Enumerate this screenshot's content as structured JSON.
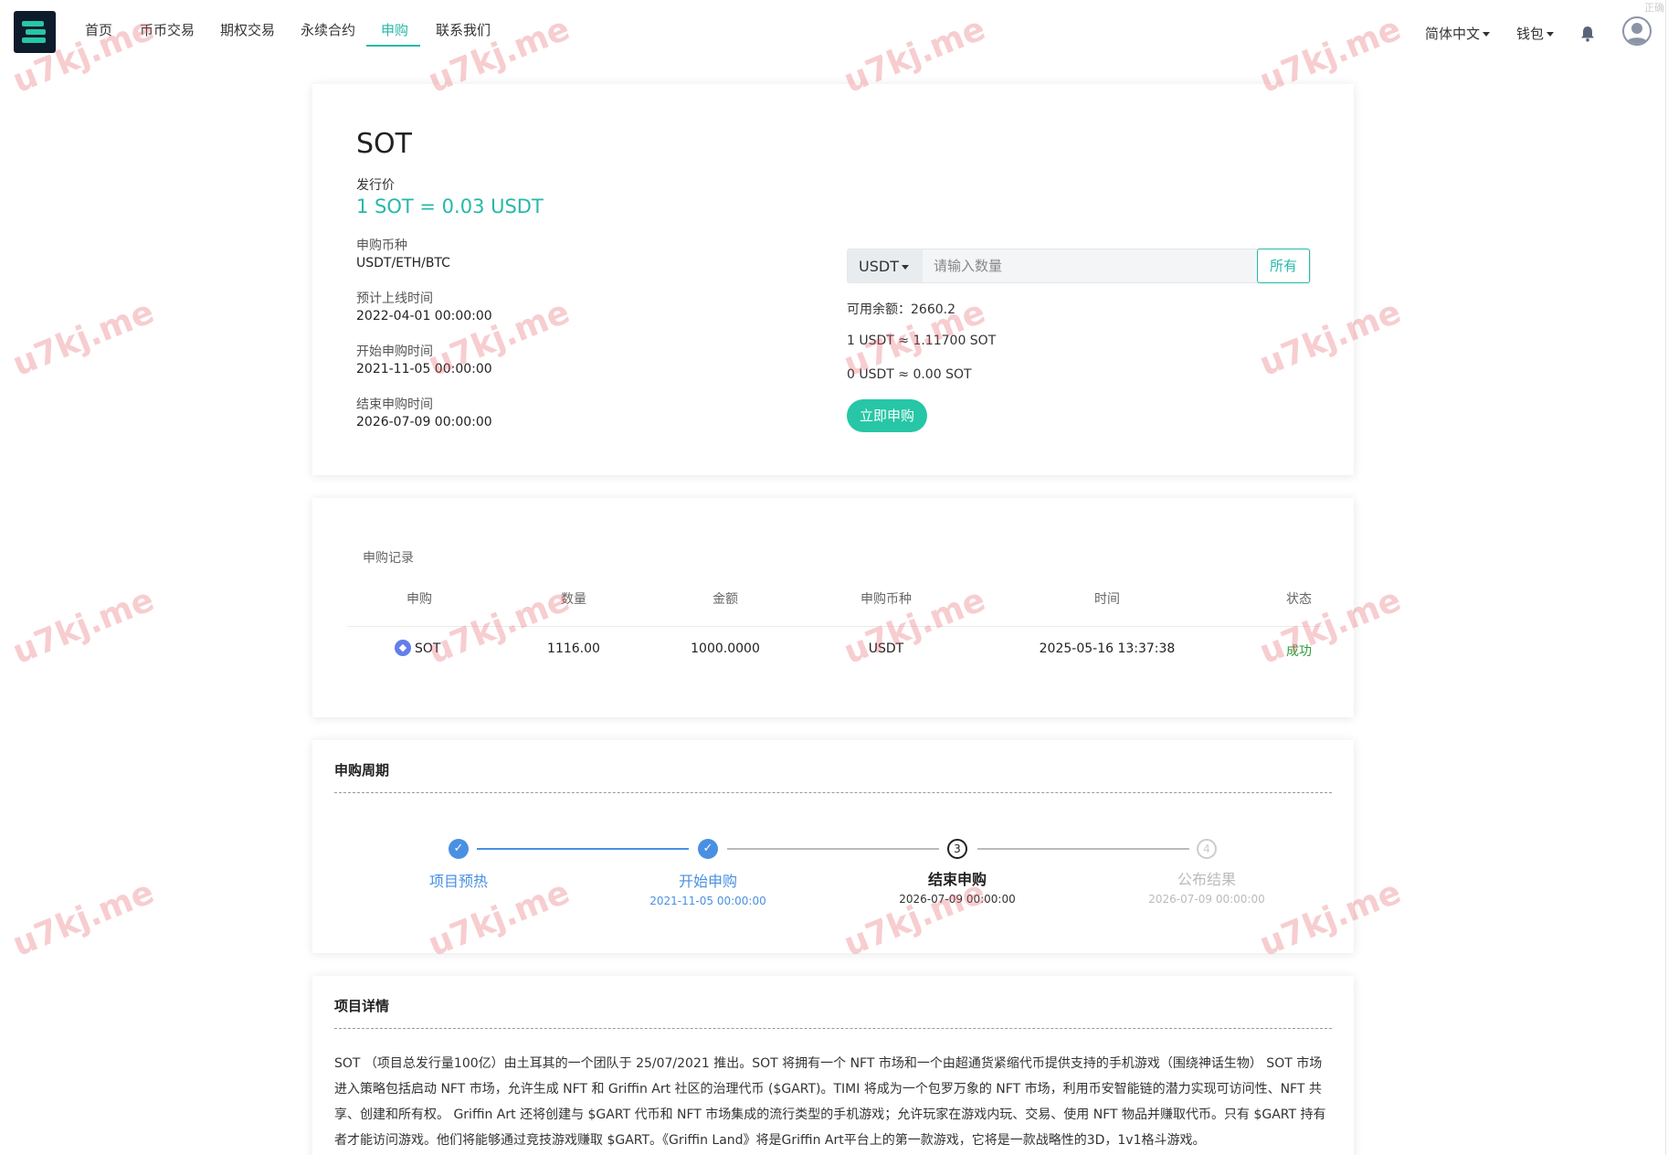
{
  "nav": {
    "items": [
      "首页",
      "币币交易",
      "期权交易",
      "永续合约",
      "申购",
      "联系我们"
    ],
    "active": "申购",
    "language": "简体中文",
    "wallet": "钱包",
    "corner_text": "正确"
  },
  "subscribe": {
    "coin": "SOT",
    "issue_price_label": "发行价",
    "issue_price": "1 SOT = 0.03 USDT",
    "currency_label": "申购币种",
    "currency_value": "USDT/ETH/BTC",
    "listing_label": "预计上线时间",
    "listing_value": "2022-04-01 00:00:00",
    "start_label": "开始申购时间",
    "start_value": "2021-11-05 00:00:00",
    "end_label": "结束申购时间",
    "end_value": "2026-07-09 00:00:00",
    "selected_currency": "USDT",
    "amount_placeholder": "请输入数量",
    "all_label": "所有",
    "balance": "可用余额：2660.2",
    "rate": "1 USDT ≈ 1.11700 SOT",
    "estimate": "0 USDT ≈ 0.00 SOT",
    "buy_label": "立即申购"
  },
  "records": {
    "title": "申购记录",
    "headers": [
      "申购",
      "数量",
      "金额",
      "申购币种",
      "时间",
      "状态"
    ],
    "rows": [
      {
        "coin": "SOT",
        "amount": "1116.00",
        "money": "1000.0000",
        "currency": "USDT",
        "time": "2025-05-16 13:37:38",
        "status": "成功"
      }
    ],
    "status_color": "#2e9e3e"
  },
  "period": {
    "title": "申购周期",
    "steps": [
      {
        "label": "项目预热",
        "date": "",
        "state": "done",
        "num": "✓"
      },
      {
        "label": "开始申购",
        "date": "2021-11-05 00:00:00",
        "state": "done",
        "num": "✓"
      },
      {
        "label": "结束申购",
        "date": "2026-07-09 00:00:00",
        "state": "current",
        "num": "3"
      },
      {
        "label": "公布结果",
        "date": "2026-07-09 00:00:00",
        "state": "todo",
        "num": "4"
      }
    ]
  },
  "details": {
    "title": "项目详情",
    "text": "SOT （项目总发行量100亿）由土耳其的一个团队于 25/07/2021 推出。SOT 将拥有一个 NFT 市场和一个由超通货紧缩代币提供支持的手机游戏（围绕神话生物） SOT 市场进入策略包括启动 NFT 市场，允许生成 NFT 和 Griffin Art 社区的治理代币 ($GART)。TIMI 将成为一个包罗万象的 NFT 市场，利用币安智能链的潜力实现可访问性、NFT 共享、创建和所有权。 Griffin Art 还将创建与 $GART 代币和 NFT 市场集成的流行类型的手机游戏；允许玩家在游戏内玩、交易、使用 NFT 物品并赚取代币。只有 $GART 持有者才能访问游戏。他们将能够通过竞技游戏赚取 $GART。《Griffin Land》将是Griffin Art平台上的第一款游戏，它将是一款战略性的3D，1v1格斗游戏。"
  },
  "watermark": "u7kj.me",
  "colors": {
    "accent": "#26b8a8",
    "button": "#26c6a6",
    "step_done": "#4a90e2"
  }
}
